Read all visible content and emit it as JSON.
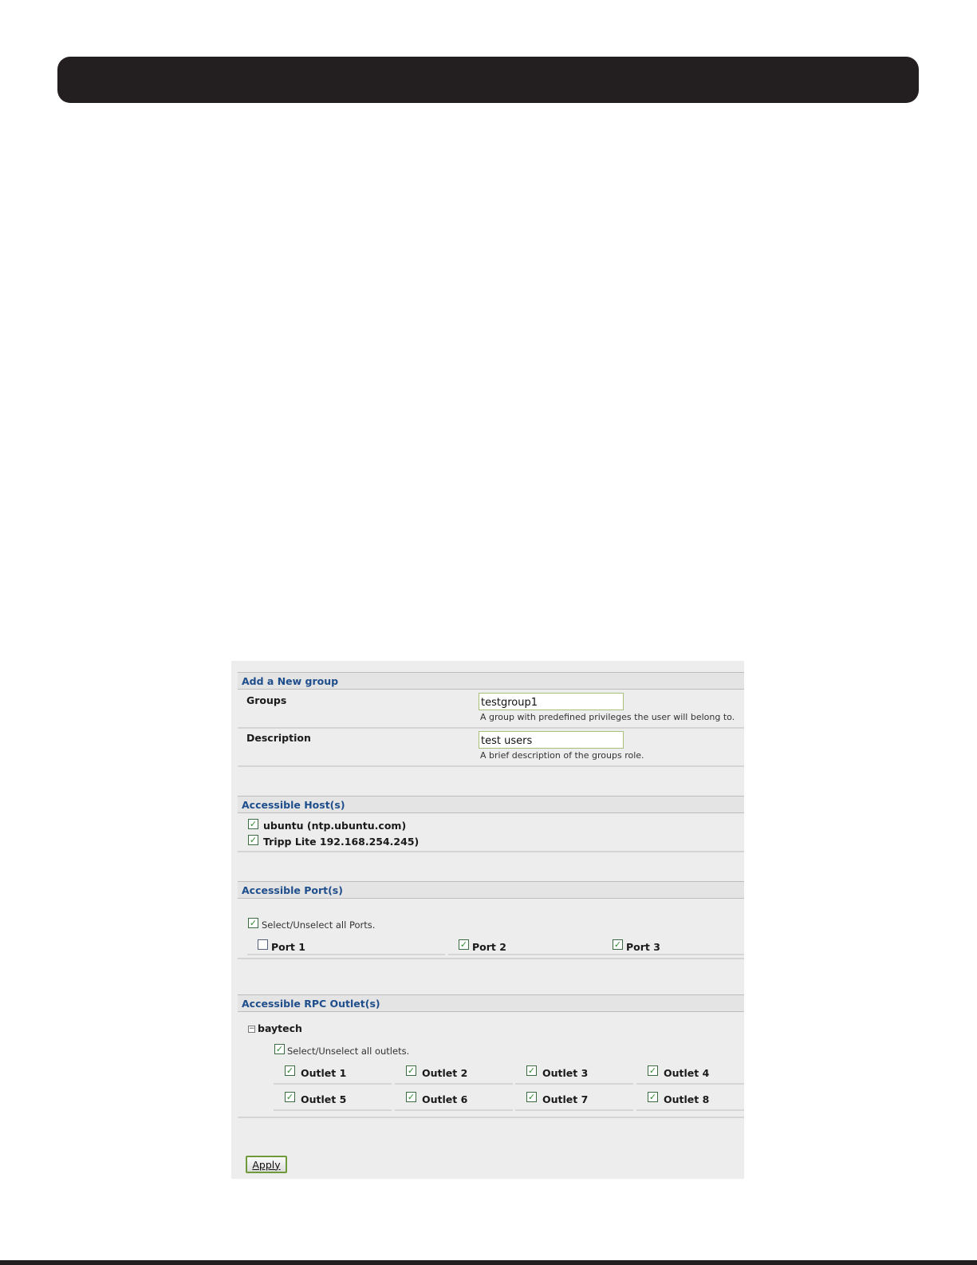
{
  "form": {
    "add_group_title": "Add a New group",
    "groups_label": "Groups",
    "groups_value": "testgroup1",
    "groups_hint": "A group with predefined privileges the user will belong to.",
    "description_label": "Description",
    "description_value": "test users",
    "description_hint": "A brief description of the groups role."
  },
  "hosts": {
    "title": "Accessible Host(s)",
    "items": [
      {
        "label": "ubuntu (ntp.ubuntu.com)",
        "checked": true
      },
      {
        "label": "Tripp Lite  192.168.254.245)",
        "checked": true
      }
    ]
  },
  "ports": {
    "title": "Accessible Port(s)",
    "select_all_label": "Select/Unselect all Ports.",
    "select_all_checked": true,
    "items": [
      {
        "label": "Port 1",
        "checked": false
      },
      {
        "label": "Port 2",
        "checked": true
      },
      {
        "label": "Port 3",
        "checked": true
      }
    ]
  },
  "outlets": {
    "title": "Accessible RPC Outlet(s)",
    "device": "baytech",
    "select_all_label": "Select/Unselect all outlets.",
    "select_all_checked": true,
    "items": [
      {
        "label": "Outlet 1",
        "checked": true
      },
      {
        "label": "Outlet 2",
        "checked": true
      },
      {
        "label": "Outlet 3",
        "checked": true
      },
      {
        "label": "Outlet 4",
        "checked": true
      },
      {
        "label": "Outlet 5",
        "checked": true
      },
      {
        "label": "Outlet 6",
        "checked": true
      },
      {
        "label": "Outlet 7",
        "checked": true
      },
      {
        "label": "Outlet 8",
        "checked": true
      }
    ]
  },
  "apply_label": "Apply",
  "colors": {
    "header_bar": "#231f20",
    "section_title": "#1f4e8c",
    "panel_bg": "#ededed",
    "checkmark": "#2f8a2f"
  }
}
